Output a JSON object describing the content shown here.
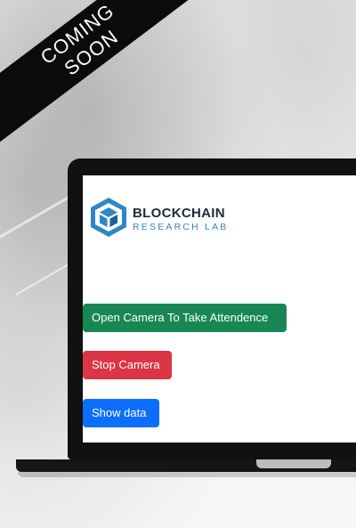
{
  "ribbon": {
    "text": "COMING SOON"
  },
  "logo": {
    "main": "BLOCKCHAIN",
    "sub": "RESEARCH LAB",
    "icon": "cube-icon"
  },
  "buttons": {
    "open_camera": "Open Camera To Take Attendence",
    "stop_camera": "Stop Camera",
    "show_data": "Show data"
  },
  "colors": {
    "open_camera": "#198754",
    "stop_camera": "#dc3545",
    "show_data": "#0d6efd",
    "logo_blue": "#2f86c4"
  }
}
